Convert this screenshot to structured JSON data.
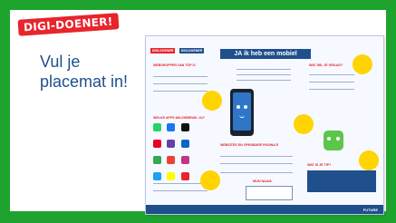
{
  "tag": "DIGI-DOENER!",
  "instruction": "Vul je placemat in!",
  "placemat": {
    "badges": [
      "DIGI-DOENER",
      "DIGI-DOENER"
    ],
    "title": "JA ik heb een mobiel",
    "labels": {
      "left_top": "WEBSHOPPEN VAN TOP 3!",
      "apps": "WELKE APPS WIL/GEBRUIK JIJ?",
      "middle_bottom": "WEBSITES EN OPENBARE PAGINA'S",
      "name": "MIJN NAAM:",
      "right_top": "WAT WIL JE GRAAG?",
      "right_bottom": "WAT IS JE TIP?",
      "footer_logo": "FUTURE"
    },
    "colors": {
      "frame": "#1fa32f",
      "navy": "#1f4f8c",
      "red": "#e8242c",
      "yellow": "#ffd400",
      "green": "#5cc64a"
    }
  }
}
